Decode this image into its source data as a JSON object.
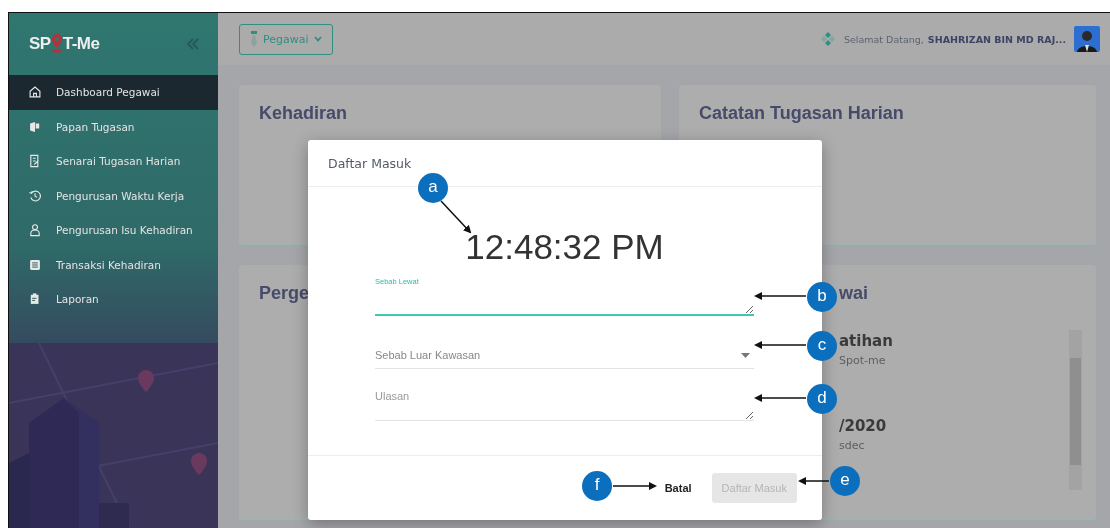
{
  "sidebar": {
    "logo": {
      "left": "SP",
      "right": "T-Me"
    },
    "items": [
      {
        "label": "Dashboard Pegawai",
        "selected": true
      },
      {
        "label": "Papan Tugasan",
        "selected": false
      },
      {
        "label": "Senarai Tugasan Harian",
        "selected": false
      },
      {
        "label": "Pengurusan Waktu Kerja",
        "selected": false
      },
      {
        "label": "Pengurusan Isu Kehadiran",
        "selected": false
      },
      {
        "label": "Transaksi Kehadiran",
        "selected": false
      },
      {
        "label": "Laporan",
        "selected": false
      }
    ]
  },
  "topbar": {
    "role_button": "Pegawai",
    "greeting": "Selamat Datang,",
    "user": "SHAHRIZAN BIN MD RAJ..."
  },
  "cards": [
    {
      "title": "Kehadiran"
    },
    {
      "title": "Catatan Tugasan Harian"
    },
    {
      "title": "Perge"
    },
    {
      "title": "wai",
      "items": [
        {
          "title": "atihan",
          "subtitle": "Spot-me"
        },
        {
          "title": "/2020",
          "subtitle": "sdec"
        }
      ]
    }
  ],
  "dialog": {
    "title": "Daftar Masuk",
    "clock": "12:48:32 PM",
    "fields": [
      {
        "kind": "textarea",
        "label": "Sebab Lewat",
        "focused": true
      },
      {
        "kind": "select",
        "placeholder": "Sebab Luar Kawasan"
      },
      {
        "kind": "textarea",
        "placeholder": "Ulasan"
      }
    ],
    "cancel": "Batal",
    "submit": {
      "label": "Daftar Masuk",
      "disabled": true
    }
  },
  "callouts": [
    {
      "letter": "a"
    },
    {
      "letter": "b"
    },
    {
      "letter": "c"
    },
    {
      "letter": "d"
    },
    {
      "letter": "e"
    },
    {
      "letter": "f"
    }
  ]
}
